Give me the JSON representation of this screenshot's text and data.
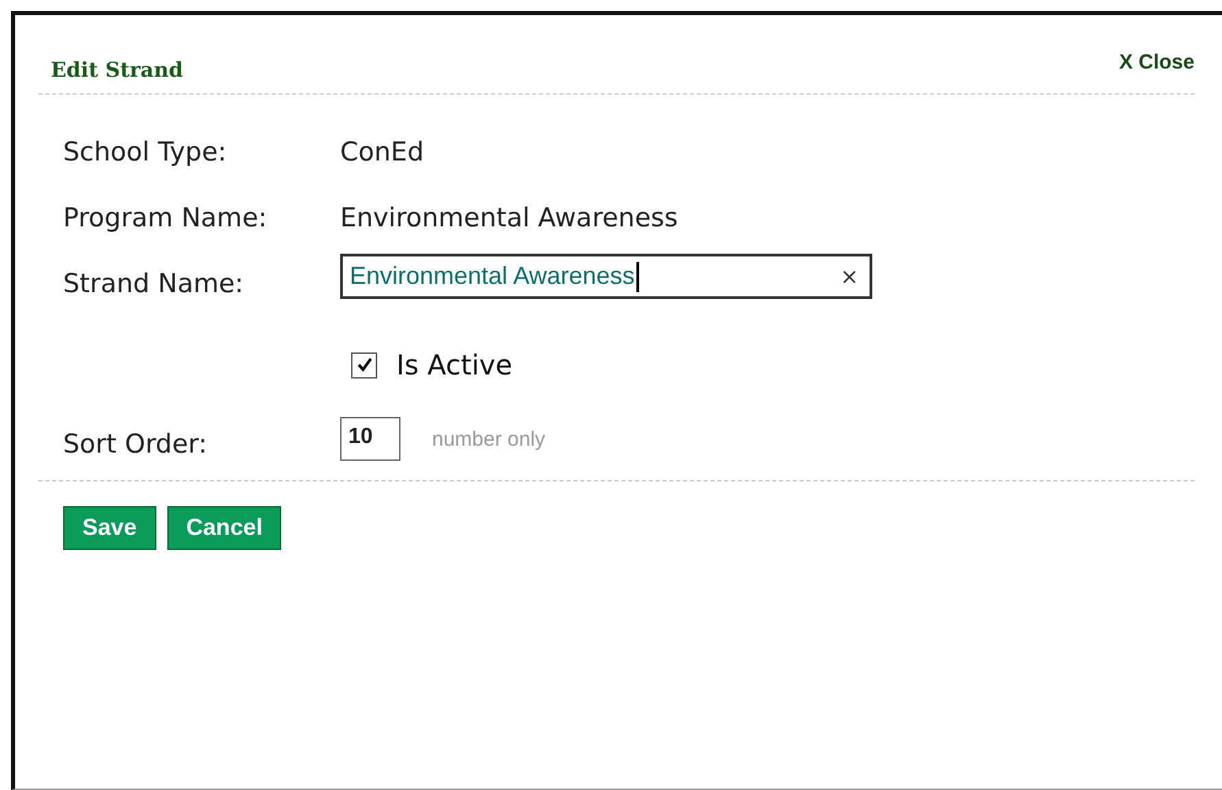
{
  "dialog": {
    "title": "Edit Strand",
    "close": "X Close"
  },
  "fields": [
    {
      "kind": "text",
      "label": "School Type:",
      "value": "ConEd"
    },
    {
      "kind": "text",
      "label": "Program Name:",
      "value": "Environmental Awareness"
    },
    {
      "kind": "input",
      "label": "Strand Name:",
      "value": "Environmental Awareness",
      "clear": "×"
    },
    {
      "kind": "checkbox",
      "label": "Is Active",
      "checked": true
    },
    {
      "kind": "number",
      "label": "Sort Order:",
      "value": "10",
      "hint": "number only"
    }
  ],
  "buttons": [
    "Save",
    "Cancel"
  ]
}
